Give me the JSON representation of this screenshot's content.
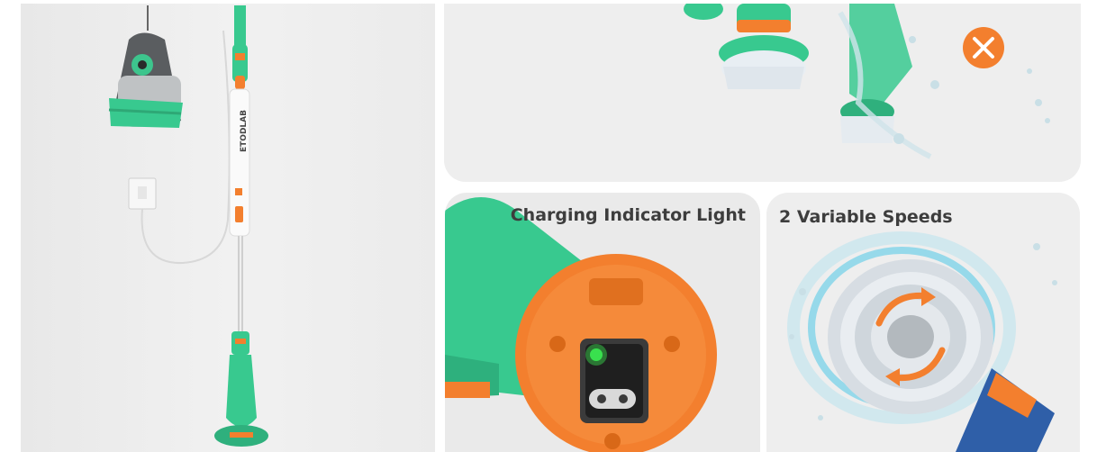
{
  "panels": {
    "charging": {
      "caption": "Charging Indicator Light"
    },
    "speeds": {
      "caption": "2 Variable Speeds"
    }
  },
  "product": {
    "brand_text": "ETODLAB"
  },
  "colors": {
    "body_green": "#38c98f",
    "accent_orange": "#f37f2e",
    "indicator_green": "#39e04e",
    "background": "#efefef"
  },
  "icons": {
    "no_water_mark": "close-circle-icon",
    "speed_arrows": "rotate-arrows-icon"
  }
}
